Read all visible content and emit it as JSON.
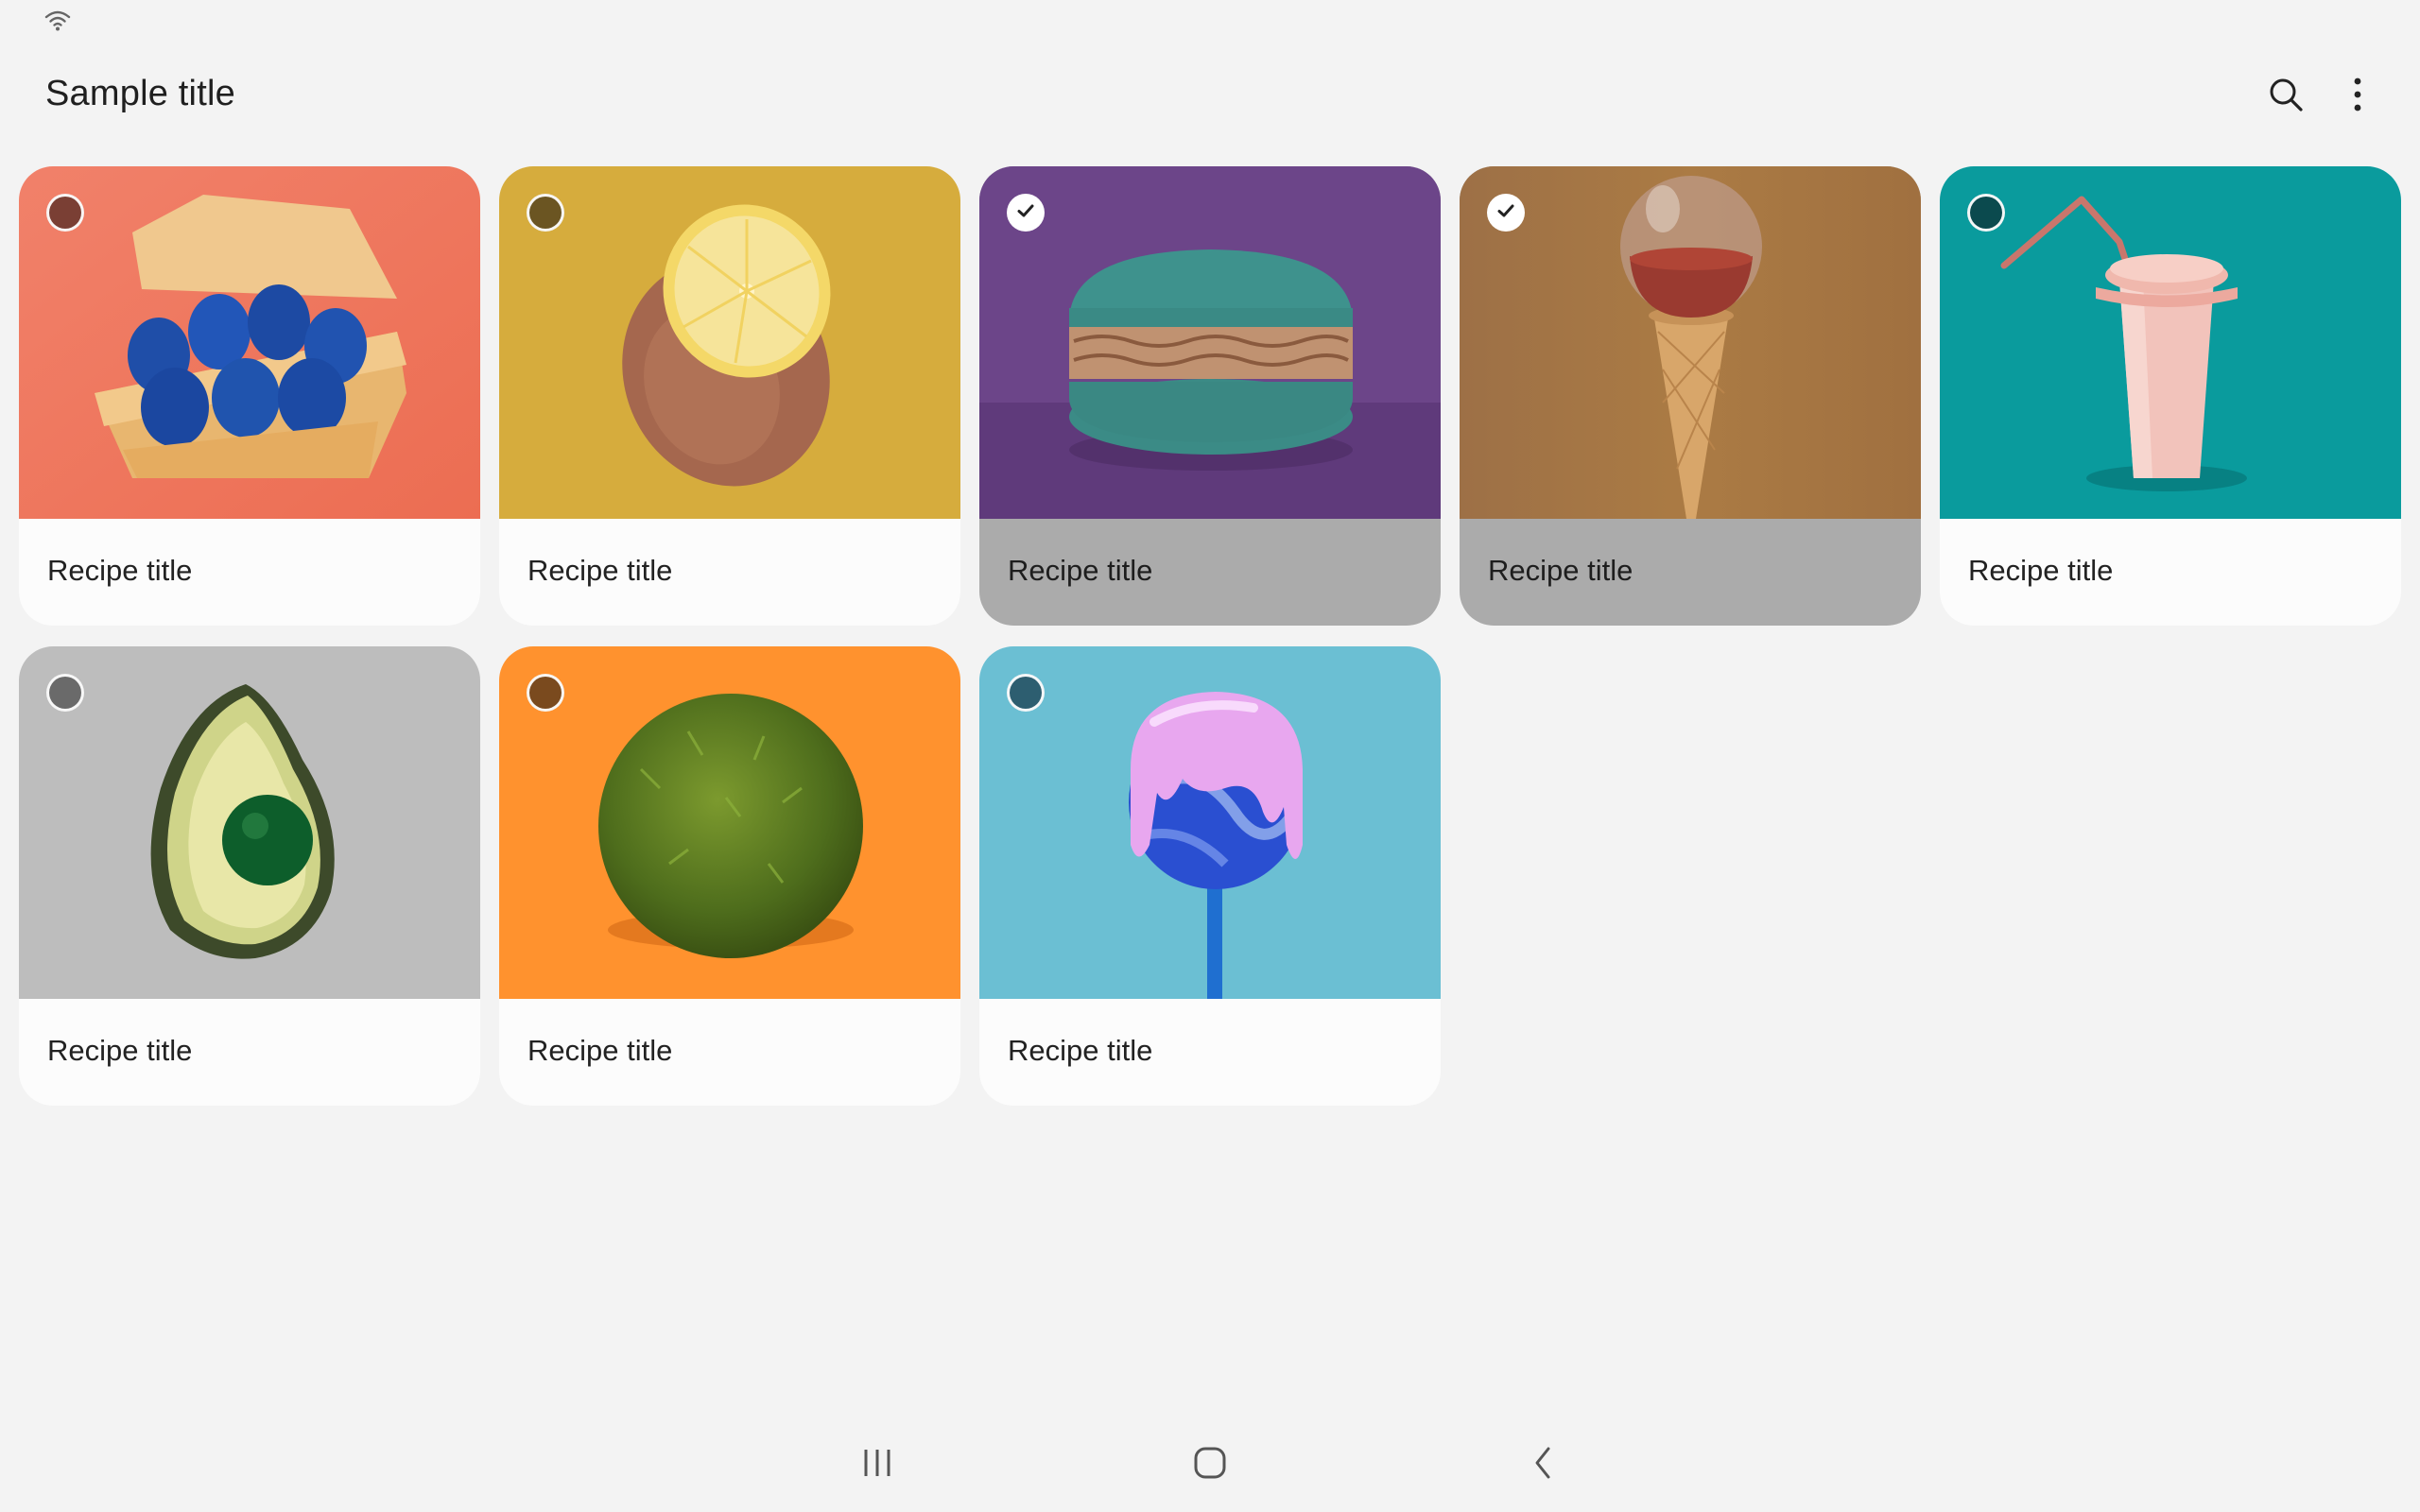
{
  "status_bar": {
    "icons": [
      "wifi-icon"
    ]
  },
  "app_bar": {
    "title": "Sample title",
    "actions": [
      {
        "icon": "search-icon"
      },
      {
        "icon": "more-vert-icon"
      }
    ]
  },
  "cards": [
    {
      "label": "Recipe title",
      "image": "blue-eggs-in-carton",
      "selected": false,
      "accent": "#7a3f34"
    },
    {
      "label": "Recipe title",
      "image": "lemon-with-bronze-peel",
      "selected": false,
      "accent": "#6b5522"
    },
    {
      "label": "Recipe title",
      "image": "teal-macaron",
      "selected": true,
      "accent": "#ffffff"
    },
    {
      "label": "Recipe title",
      "image": "ice-cream-cone-globe",
      "selected": true,
      "accent": "#ffffff"
    },
    {
      "label": "Recipe title",
      "image": "paper-cup-with-straw",
      "selected": false,
      "accent": "#0b4a4e"
    },
    {
      "label": "Recipe title",
      "image": "avocado-with-green-ball",
      "selected": false,
      "accent": "#6a6a6a"
    },
    {
      "label": "Recipe title",
      "image": "green-moss-ball",
      "selected": false,
      "accent": "#7a4a1e"
    },
    {
      "label": "Recipe title",
      "image": "lollipop-with-drip",
      "selected": false,
      "accent": "#2d5e70"
    }
  ],
  "colors": {
    "background": "#f3f3f3",
    "card": "#fcfcfc",
    "card_selected": "#ababab",
    "egg_bg": "#f07a5f",
    "lemon_bg": "#d6ac3d",
    "macaron_bg": "#6c4589",
    "cone_bg": "#a6773f",
    "cup_bg": "#0a9b9d",
    "avocado_bg": "#bdbdbd",
    "moss_bg": "#ff922e",
    "lollipop_bg": "#6bbfd3"
  },
  "nav_bar": {
    "buttons": [
      {
        "icon": "recents-icon"
      },
      {
        "icon": "home-icon"
      },
      {
        "icon": "back-icon"
      }
    ]
  }
}
